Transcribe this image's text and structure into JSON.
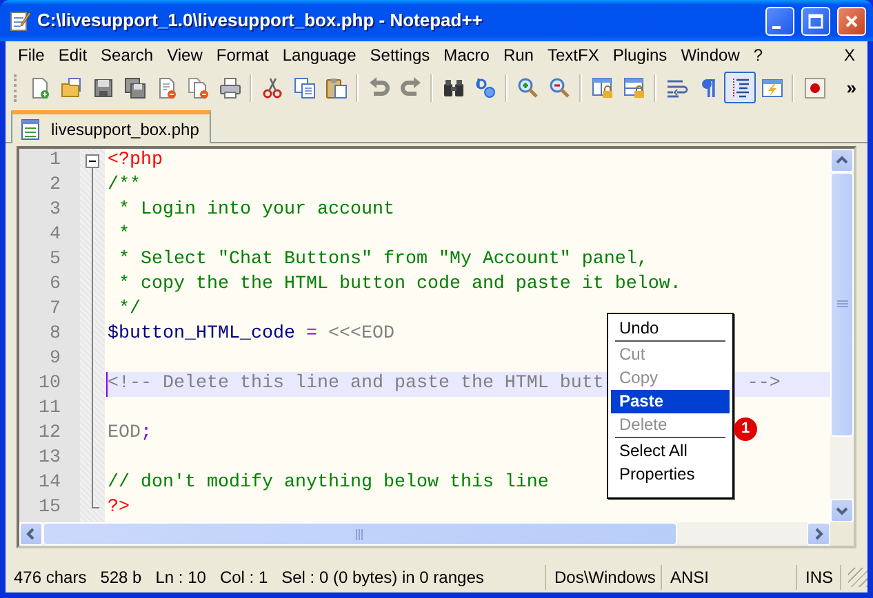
{
  "window": {
    "title": "C:\\livesupport_1.0\\livesupport_box.php - Notepad++"
  },
  "menu_bar": {
    "items": [
      "File",
      "Edit",
      "Search",
      "View",
      "Format",
      "Language",
      "Settings",
      "Macro",
      "Run",
      "TextFX",
      "Plugins",
      "Window",
      "?"
    ],
    "close_document": "X"
  },
  "toolbar": {
    "groups": [
      [
        {
          "pressed": false
        },
        {
          "pressed": false
        },
        {
          "pressed": false
        },
        {
          "pressed": false
        },
        {
          "pressed": false
        },
        {
          "pressed": false
        },
        {
          "pressed": false
        }
      ],
      [
        {
          "pressed": false
        },
        {
          "pressed": false
        },
        {
          "pressed": false
        }
      ],
      [
        {
          "pressed": false
        },
        {
          "pressed": false
        }
      ],
      [
        {
          "pressed": false
        },
        {
          "pressed": false
        }
      ],
      [
        {
          "pressed": false
        },
        {
          "pressed": false
        }
      ],
      [
        {
          "pressed": false
        },
        {
          "pressed": false
        }
      ],
      [
        {
          "pressed": false
        },
        {
          "pressed": false
        },
        {
          "pressed": true
        },
        {
          "pressed": false
        }
      ],
      [
        {
          "pressed": false
        }
      ]
    ],
    "overflow": "»"
  },
  "tabs": [
    {
      "label": "livesupport_box.php",
      "selected": true
    }
  ],
  "editor": {
    "lines": [
      {
        "number": "1",
        "current": false,
        "tokens": [
          {
            "text": "<?php",
            "kind": "php-tag"
          }
        ]
      },
      {
        "number": "2",
        "current": false,
        "tokens": [
          {
            "text": "/**",
            "kind": "comment"
          }
        ]
      },
      {
        "number": "3",
        "current": false,
        "tokens": [
          {
            "text": " * Login into your account",
            "kind": "comment"
          }
        ]
      },
      {
        "number": "4",
        "current": false,
        "tokens": [
          {
            "text": " *",
            "kind": "comment"
          }
        ]
      },
      {
        "number": "5",
        "current": false,
        "tokens": [
          {
            "text": " * Select \"Chat Buttons\" from \"My Account\" panel,",
            "kind": "comment"
          }
        ]
      },
      {
        "number": "6",
        "current": false,
        "tokens": [
          {
            "text": " * copy the the HTML button code and paste it below.",
            "kind": "comment"
          }
        ]
      },
      {
        "number": "7",
        "current": false,
        "tokens": [
          {
            "text": " */",
            "kind": "comment"
          }
        ]
      },
      {
        "number": "8",
        "current": false,
        "tokens": [
          {
            "text": "$button_HTML_code",
            "kind": "variable"
          },
          {
            "text": " =",
            "kind": "operator"
          },
          {
            "text": " <<<EOD",
            "kind": "heredoc"
          }
        ]
      },
      {
        "number": "9",
        "current": false
      },
      {
        "number": "10",
        "current": true,
        "tokens": [
          {
            "text": "<!-- Delete this line and paste the HTML butt",
            "kind": "heredoc"
          },
          {
            "text": "-->",
            "kind": "heredoc",
            "after_cover": true
          }
        ]
      },
      {
        "number": "11",
        "current": false
      },
      {
        "number": "12",
        "current": false,
        "tokens": [
          {
            "text": "EOD",
            "kind": "heredoc"
          },
          {
            "text": ";",
            "kind": "operator"
          }
        ]
      },
      {
        "number": "13",
        "current": false
      },
      {
        "number": "14",
        "current": false,
        "tokens": [
          {
            "text": "// don't modify anything below this line",
            "kind": "comment"
          }
        ]
      },
      {
        "number": "15",
        "current": false,
        "tokens": [
          {
            "text": "?>",
            "kind": "php-tag"
          }
        ]
      }
    ]
  },
  "context_menu": {
    "items": [
      {
        "kind": "item",
        "label": "Undo",
        "disabled": false,
        "selected": false
      },
      {
        "kind": "separator"
      },
      {
        "kind": "item",
        "label": "Cut",
        "disabled": true,
        "selected": false
      },
      {
        "kind": "item",
        "label": "Copy",
        "disabled": true,
        "selected": false
      },
      {
        "kind": "item",
        "label": "Paste",
        "disabled": false,
        "selected": true
      },
      {
        "kind": "item",
        "label": "Delete",
        "disabled": true,
        "selected": false
      },
      {
        "kind": "separator"
      },
      {
        "kind": "item",
        "label": "Select All",
        "disabled": false,
        "selected": false
      },
      {
        "kind": "item",
        "label": "Properties",
        "disabled": false,
        "selected": false
      }
    ]
  },
  "callout": "1",
  "status_bar": {
    "panels": [
      [
        "476 chars",
        "528 b",
        "Ln : 10",
        "Col : 1",
        "Sel : 0 (0 bytes) in 0 ranges"
      ],
      [
        "Dos\\Windows"
      ],
      [
        "ANSI"
      ],
      [
        "INS"
      ]
    ]
  }
}
